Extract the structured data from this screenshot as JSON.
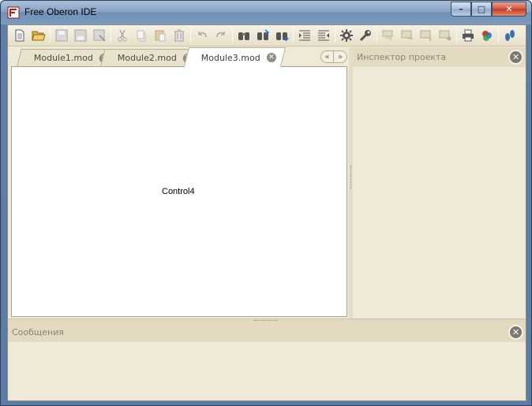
{
  "window": {
    "title": "Free Oberon IDE",
    "controls": {
      "minimize": "–",
      "maximize": "□",
      "close": "✕"
    }
  },
  "toolbar": {
    "groups": [
      [
        "new-file-icon",
        "open-folder-icon"
      ],
      [
        "save-icon",
        "save-as-icon",
        "save-all-icon"
      ],
      [
        "cut-icon",
        "copy-icon",
        "paste-icon",
        "delete-icon"
      ],
      [
        "undo-icon",
        "redo-icon"
      ],
      [
        "find-icon",
        "find-next-icon",
        "find-replace-icon"
      ],
      [
        "indent-icon",
        "outdent-icon"
      ],
      [
        "compile-gear-icon",
        "settings-wrench-icon"
      ],
      [
        "step-into-icon",
        "step-over-icon",
        "step-out-icon",
        "breakpoint-icon"
      ],
      [
        "print-icon",
        "colors-icon"
      ],
      [
        "run-icon"
      ]
    ]
  },
  "tabs": [
    {
      "label": "Module1.mod",
      "active": false
    },
    {
      "label": "Module2.mod",
      "active": false
    },
    {
      "label": "Module3.mod",
      "active": true
    }
  ],
  "tab_nav": {
    "prev": "«",
    "next": "»"
  },
  "editor": {
    "control_label": "Control4"
  },
  "inspector": {
    "title": "Инспектор проекта",
    "close": "✕"
  },
  "messages": {
    "title": "Сообщения",
    "close": "✕"
  },
  "colors": {
    "panel_bg": "#efe9d8",
    "header_bg": "#e3dac1",
    "accent_red": "#c13a22"
  }
}
